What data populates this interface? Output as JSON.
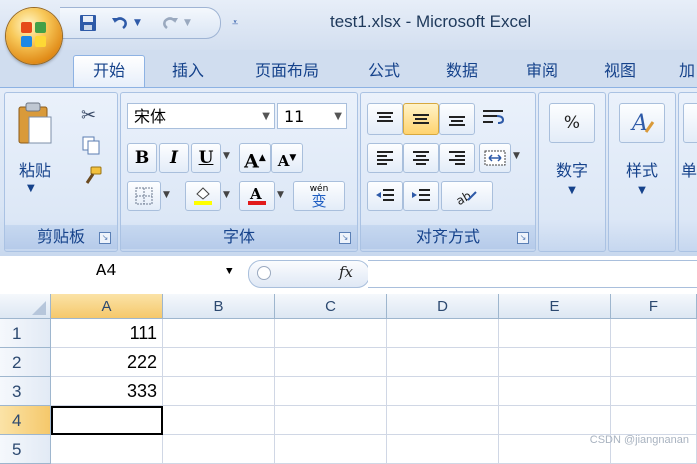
{
  "window": {
    "title": "test1.xlsx - Microsoft Excel"
  },
  "quick_access": {
    "save_icon": "save-icon",
    "undo_icon": "undo-icon",
    "redo_icon": "redo-icon",
    "customize_icon": "customize-qat-icon"
  },
  "tabs": [
    {
      "label": "开始",
      "active": true
    },
    {
      "label": "插入",
      "active": false
    },
    {
      "label": "页面布局",
      "active": false
    },
    {
      "label": "公式",
      "active": false
    },
    {
      "label": "数据",
      "active": false
    },
    {
      "label": "审阅",
      "active": false
    },
    {
      "label": "视图",
      "active": false
    },
    {
      "label": "加",
      "active": false
    }
  ],
  "ribbon": {
    "clipboard": {
      "label": "剪贴板",
      "paste_label": "粘贴"
    },
    "font": {
      "label": "字体",
      "font_name": "宋体",
      "font_size": "11",
      "bold": "B",
      "italic": "I",
      "underline": "U",
      "grow_font": "A",
      "shrink_font": "A",
      "phonetic": "wén",
      "phonetic_char": "变"
    },
    "alignment": {
      "label": "对齐方式"
    },
    "number": {
      "label": "数字",
      "percent": "%"
    },
    "styles": {
      "label": "样式",
      "icon_letter": "A"
    },
    "cells": {
      "label": "单"
    }
  },
  "formula_bar": {
    "name_box": "A4",
    "fx_label": "fx",
    "formula": ""
  },
  "grid": {
    "columns": [
      "A",
      "B",
      "C",
      "D",
      "E",
      "F"
    ],
    "rows": [
      {
        "num": "1",
        "cells": [
          "111",
          "",
          "",
          "",
          "",
          ""
        ]
      },
      {
        "num": "2",
        "cells": [
          "222",
          "",
          "",
          "",
          "",
          ""
        ]
      },
      {
        "num": "3",
        "cells": [
          "333",
          "",
          "",
          "",
          "",
          ""
        ]
      },
      {
        "num": "4",
        "cells": [
          "",
          "",
          "",
          "",
          "",
          ""
        ]
      },
      {
        "num": "5",
        "cells": [
          "",
          "",
          "",
          "",
          "",
          ""
        ]
      }
    ],
    "active_cell": "A4"
  },
  "watermark": "CSDN @jiangnanan",
  "colors": {
    "ribbon_text": "#15428b",
    "font_color_bar": "#e11a1a",
    "highlight_bar": "#ffff00"
  }
}
